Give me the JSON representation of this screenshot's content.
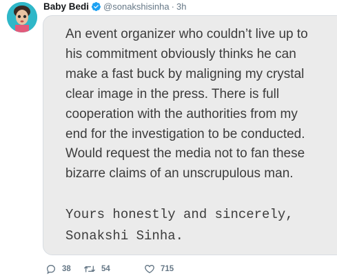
{
  "tweet": {
    "display_name": "Baby Bedi",
    "handle": "@sonakshisinha",
    "separator": "·",
    "time": "3h",
    "verified": true,
    "avatar_icon": "profile-avatar"
  },
  "image_note": {
    "lines": [
      "An event organizer who couldn’t live up to",
      "his commitment obviously thinks he can",
      "make a fast buck by maligning my crystal",
      "clear image in the press. There is full",
      "cooperation with the authorities from my",
      "end for the investigation to be conducted.",
      "Would request the media not to fan these",
      "bizarre claims of an unscrupulous man."
    ],
    "signoff": [
      "Yours honestly and sincerely,",
      "Sonakshi Sinha."
    ]
  },
  "actions": {
    "reply_count": "38",
    "retweet_count": "54",
    "like_count": "715",
    "reply_icon": "reply-icon",
    "retweet_icon": "retweet-icon",
    "like_icon": "heart-icon"
  },
  "colors": {
    "accent": "#1da1f2",
    "muted": "#657786",
    "card_bg": "#ebebeb"
  }
}
